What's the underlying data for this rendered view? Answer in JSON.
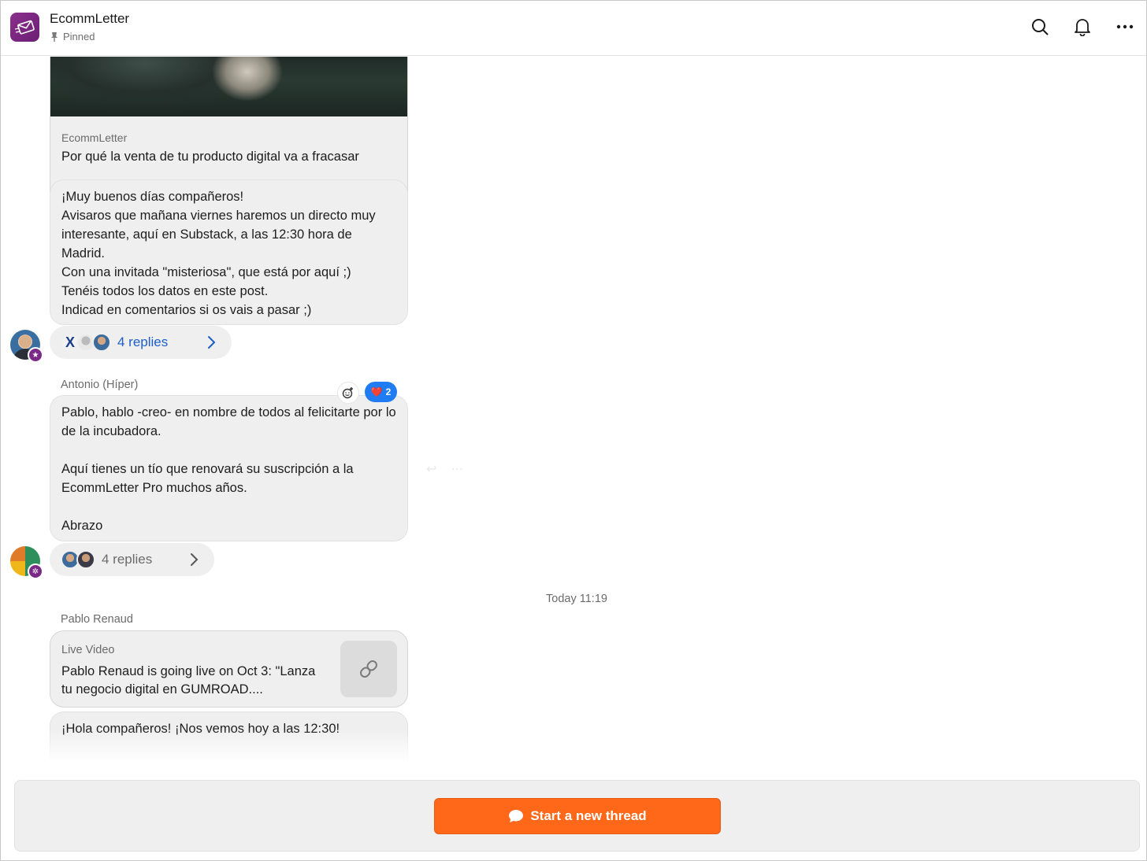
{
  "header": {
    "title": "EcommLetter",
    "pinned_label": "Pinned",
    "icons": [
      "search-icon",
      "bell-icon",
      "more-icon"
    ]
  },
  "feed": {
    "post_card": {
      "source": "EcommLetter",
      "title": "Por qué la venta de tu producto digital va a fracasar"
    },
    "message1": {
      "text": "¡Muy buenos días compañeros!\nAvisaros que mañana viernes haremos un directo muy interesante, aquí en Substack, a las 12:30 hora de Madrid.\nCon una invitada \"misteriosa\", que está por aquí ;)\nTenéis todos los datos en este post.\nIndicad en comentarios si os vais a pasar ;)",
      "replies_label": "4 replies"
    },
    "message2": {
      "author": "Antonio (Híper)",
      "text": "Pablo, hablo -creo- en nombre de todos al felicitarte por lo de la incubadora.\n\nAquí tienes un tío que renovará su suscripción a la EcommLetter Pro muchos años.\n\nAbrazo",
      "reaction_emoji": "❤️",
      "reaction_count": "2",
      "replies_label": "4 replies"
    },
    "timestamp": "Today 11:19",
    "message3": {
      "author": "Pablo Renaud",
      "live_kind": "Live Video",
      "live_title": "Pablo Renaud is going live on Oct 3: \"Lanza tu negocio digital en GUMROAD....",
      "text": "¡Hola compañeros! ¡Nos vemos hoy a las 12:30!"
    }
  },
  "footer": {
    "cta_label": "Start a new thread"
  },
  "colors": {
    "accent": "#ff6719",
    "bubble": "#efefef",
    "link_blue": "#1c5fc9",
    "reaction_blue": "#1f7cf3",
    "brand_purple": "#7a2a86"
  }
}
